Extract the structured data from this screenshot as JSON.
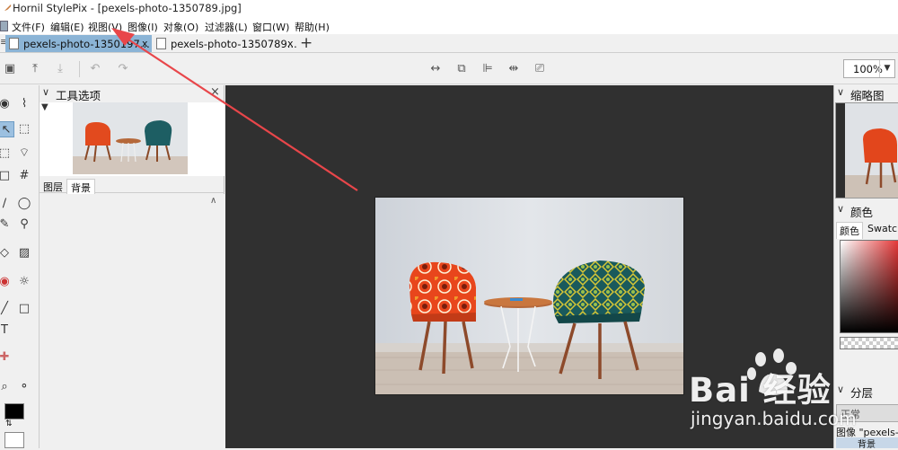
{
  "window": {
    "title": "Hornil StylePix - [pexels-photo-1350789.jpg]"
  },
  "menu": [
    "文件(F)",
    "编辑(E)",
    "视图(V)",
    "图像(I)",
    "对象(O)",
    "过滤器(L)",
    "窗口(W)",
    "帮助(H)"
  ],
  "tabs": [
    {
      "label": "pexels-photo-1350197...",
      "close": "x",
      "active": true
    },
    {
      "label": "pexels-photo-1350789...",
      "close": "x",
      "active": false
    }
  ],
  "new_tab": "+",
  "toolbar": {
    "zoom": "100%"
  },
  "tool_options": {
    "title": "工具选项",
    "close": "×",
    "layer_tabs": [
      "图层",
      "背景"
    ]
  },
  "navigator": {
    "title": "缩略图"
  },
  "color_panel": {
    "title": "颜色",
    "tabs": [
      "颜色",
      "Swatch"
    ]
  },
  "layers_panel": {
    "title": "分层",
    "mode": "正常",
    "layer_row": "图像 \"pexels-p",
    "layer_sub": "背景"
  },
  "watermark": {
    "brand": "Bai 经验",
    "url": "jingyan.baidu.com"
  },
  "colors": {
    "accent": "#8bb4d6",
    "canvas_bg": "#303030",
    "arrow": "#e8464a"
  }
}
